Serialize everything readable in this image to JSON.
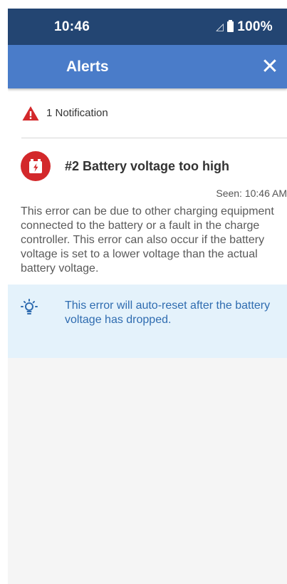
{
  "status_bar": {
    "time": "10:46",
    "battery_percent": "100%"
  },
  "app_bar": {
    "title": "Alerts",
    "close_icon": "close-icon"
  },
  "notifications": {
    "summary": "1 Notification",
    "items": [
      {
        "title": "#2 Battery voltage too high",
        "seen": "Seen: 10:46 AM",
        "description": "This error can be due to other charging equipment connected to the battery or a fault in the charge controller. This error can also occur if the battery voltage is set to a lower voltage than the actual battery voltage.",
        "tip": "This error will auto-reset after the battery voltage has dropped.",
        "icon": "battery-alert-icon"
      }
    ]
  },
  "colors": {
    "status_bar": "#234572",
    "app_bar": "#4a7cc9",
    "alert_red": "#d3282b",
    "tip_background": "#e4f2fb",
    "tip_text": "#2f6cb0"
  }
}
